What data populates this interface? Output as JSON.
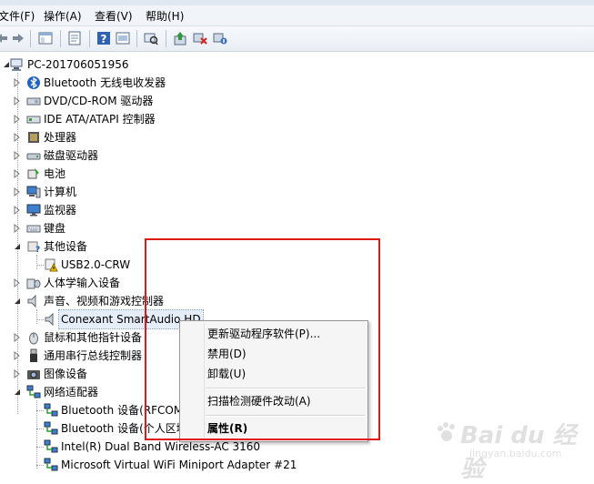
{
  "menubar": {
    "items": [
      "文件(F)",
      "操作(A)",
      "查看(V)",
      "帮助(H)"
    ]
  },
  "toolbar": {
    "icons": [
      "back-arrow-icon",
      "forward-arrow-icon",
      "console-tree-icon",
      "properties-icon",
      "help-icon",
      "view-icon",
      "scan-hardware-icon",
      "update-driver-icon",
      "uninstall-icon",
      "disable-icon"
    ]
  },
  "tree": {
    "root": "PC-201706051956",
    "nodes": [
      {
        "label": "Bluetooth 无线电收发器",
        "icon": "bluetooth-icon"
      },
      {
        "label": "DVD/CD-ROM 驱动器",
        "icon": "dvd-drive-icon"
      },
      {
        "label": "IDE ATA/ATAPI 控制器",
        "icon": "ide-controller-icon"
      },
      {
        "label": "处理器",
        "icon": "processor-icon"
      },
      {
        "label": "磁盘驱动器",
        "icon": "disk-drive-icon"
      },
      {
        "label": "电池",
        "icon": "battery-icon"
      },
      {
        "label": "计算机",
        "icon": "computer-icon"
      },
      {
        "label": "监视器",
        "icon": "monitor-icon"
      },
      {
        "label": "键盘",
        "icon": "keyboard-icon"
      },
      {
        "label": "其他设备",
        "icon": "other-devices-icon"
      },
      {
        "label": "USB2.0-CRW",
        "icon": "warning-device-icon"
      },
      {
        "label": "人体学输入设备",
        "icon": "hid-icon"
      },
      {
        "label": "声音、视频和游戏控制器",
        "icon": "speaker-icon"
      },
      {
        "label": "Conexant SmartAudio HD",
        "icon": "speaker-icon"
      },
      {
        "label": "鼠标和其他指针设备",
        "icon": "mouse-icon"
      },
      {
        "label": "通用串行总线控制器",
        "icon": "usb-icon"
      },
      {
        "label": "图像设备",
        "icon": "camera-icon"
      },
      {
        "label": "网络适配器",
        "icon": "network-icon"
      },
      {
        "label": "Bluetooth 设备(RFCOMM",
        "icon": "network-icon"
      },
      {
        "label": "Bluetooth 设备(个人区域",
        "icon": "network-icon"
      },
      {
        "label": "Intel(R) Dual Band Wireless-AC 3160",
        "icon": "network-icon"
      },
      {
        "label": "Microsoft Virtual WiFi Miniport Adapter #21",
        "icon": "network-icon"
      }
    ]
  },
  "context_menu": {
    "items": [
      "更新驱动程序软件(P)...",
      "禁用(D)",
      "卸载(U)",
      "扫描检测硬件改动(A)",
      "属性(R)"
    ]
  },
  "watermark": {
    "text": "Bai du 经验",
    "sub": "jingyan.baidu.com"
  },
  "colors": {
    "highlight_box": "#e01818",
    "menu_bg": "#f5f5f5"
  }
}
